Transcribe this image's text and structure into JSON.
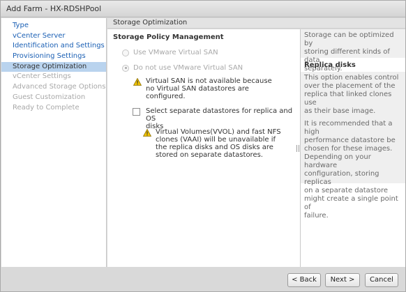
{
  "window": {
    "title": "Add Farm - HX-RDSHPool"
  },
  "nav": {
    "items": [
      {
        "label": "Type",
        "state": "link"
      },
      {
        "label": "vCenter Server",
        "state": "link"
      },
      {
        "label": "Identification and Settings",
        "state": "link"
      },
      {
        "label": "Provisioning Settings",
        "state": "link"
      },
      {
        "label": "Storage Optimization",
        "state": "active"
      },
      {
        "label": "vCenter Settings",
        "state": "disabled"
      },
      {
        "label": "Advanced Storage Options",
        "state": "disabled"
      },
      {
        "label": "Guest Customization",
        "state": "disabled"
      },
      {
        "label": "Ready to Complete",
        "state": "disabled"
      }
    ]
  },
  "content": {
    "header": "Storage Optimization",
    "section_title": "Storage Policy Management",
    "radio_use_vsan": "Use VMware Virtual SAN",
    "radio_no_vsan": "Do not use VMware Virtual SAN",
    "vsan_warning": [
      "Virtual SAN is not available because",
      "no Virtual SAN datastores are",
      "configured."
    ],
    "separate_datastores_label": [
      "Select separate datastores for replica and OS",
      "disks"
    ],
    "vvol_warning": [
      "Virtual Volumes(VVOL) and fast NFS",
      "clones (VAAI) will be unavailable if",
      "the replica disks and OS disks are",
      "stored on separate datastores."
    ]
  },
  "help": {
    "intro": [
      "Storage can be optimized by",
      "storing different kinds of data",
      "separately."
    ],
    "heading": "Replica disks",
    "para1": [
      "This option enables control",
      "over the placement of the",
      "replica that linked clones use",
      "as their base image."
    ],
    "para2": [
      "It is recommended that a high",
      "performance datastore be",
      "chosen for these images.",
      "Depending on your hardware",
      "configuration, storing replicas",
      "on a separate datastore",
      "might create a single point of",
      "failure."
    ]
  },
  "footer": {
    "back_label": "< Back",
    "next_label": "Next >",
    "cancel_label": "Cancel"
  },
  "colors": {
    "link": "#1a5fb4",
    "active_nav": "#b9d3ee",
    "disabled": "#a8a8a8",
    "warning": "#f2c500"
  }
}
